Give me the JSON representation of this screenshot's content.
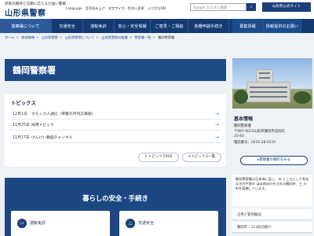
{
  "header": {
    "tagline": "県民の期待と信頼に応える力強い警察",
    "logo": "山形県警察",
    "utility": [
      "Language",
      "音声読み上げ",
      "文字サイズ・色合い変更",
      "ふりがなON"
    ],
    "search_placeholder": "Google カスタム検索",
    "search_button": "検索",
    "official_site": "山形県公式サイト"
  },
  "nav": [
    "警察署について",
    "交通安全",
    "運転免許",
    "安心・安全情報",
    "ご意見・ご相談",
    "各種申請手続き",
    "募集情報",
    "情報提供のお願い"
  ],
  "breadcrumb": [
    "ホーム",
    "県政情報",
    "山形県警察",
    "山形県警察について",
    "山形県警察の組織",
    "警察署一覧",
    "鶴岡警察署"
  ],
  "page_title": "鶴岡警察署",
  "topics": {
    "title": "トピックス",
    "items": [
      {
        "date": "12月1日",
        "text": "カモシカ人通信（県警の月刊広報紙）"
      },
      {
        "date": "11月25日",
        "text": "採用トピック"
      },
      {
        "date": "11月17日",
        "text": "けんけい動画チャンネル"
      }
    ],
    "rss_button": "トピックスRSS",
    "list_button": "トピックス一覧"
  },
  "safety": {
    "title": "暮らしの安全・手続き",
    "cards": [
      "運転免許",
      "交通安全"
    ]
  },
  "info": {
    "title": "基本情報",
    "lines": [
      "鶴岡警察署",
      "〒997-0015山形県鶴岡市道形町",
      "20-40",
      "電話番号：0235-28-0110"
    ],
    "guide_button": "警察署の場所をみる"
  },
  "description": "鶴岡警察署は日本海に面し、み ところとして有名な庄内平野の ほぼ南半分を占める鶴岡市、三 川町を管轄しています。",
  "side_links": [
    "沿革と管内概況",
    "鶴岡市・三川町の紹介"
  ]
}
